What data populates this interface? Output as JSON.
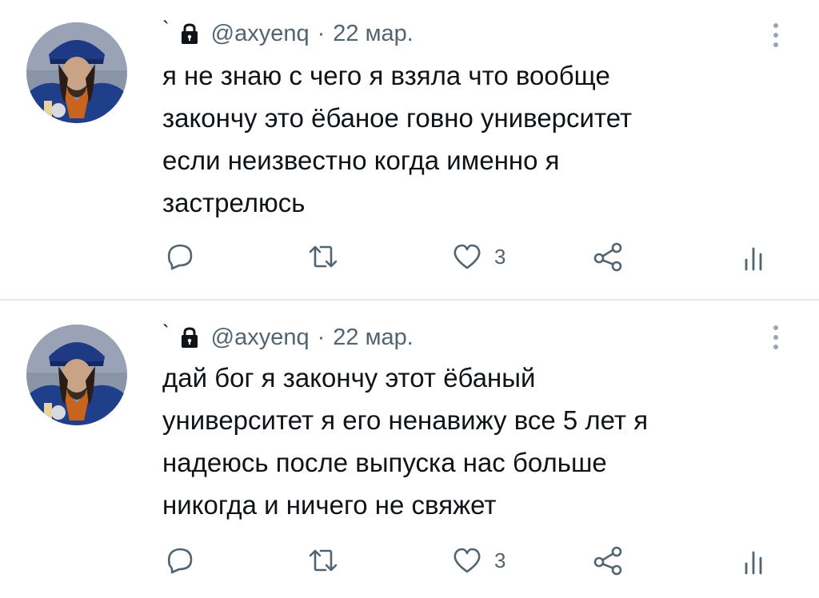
{
  "tweets": [
    {
      "marker": "`",
      "handle": "@axyenq",
      "separator": "·",
      "date": "22 мар.",
      "text": "я не знаю с чего я взяла что вообще\nзакончу это ёбаное говно университет\nесли неизвестно когда именно я\nзастрелюсь",
      "like_count": "3"
    },
    {
      "marker": "`",
      "handle": "@axyenq",
      "separator": "·",
      "date": "22 мар.",
      "text": "дай бог я закончу этот ёбаный\nуниверситет я его ненавижу все 5 лет я\nнадеюсь после выпуска нас больше\nникогда и ничего не свяжет",
      "like_count": "3"
    }
  ],
  "icons": {
    "reply": "reply-icon",
    "retweet": "retweet-icon",
    "like": "heart-icon",
    "share": "share-icon",
    "views": "analytics-icon",
    "lock": "lock-icon",
    "more": "more-vertical-icon"
  },
  "colors": {
    "text": "#0f1419",
    "secondary": "#536471",
    "icon": "#536471",
    "divider": "#e6e9ec"
  }
}
